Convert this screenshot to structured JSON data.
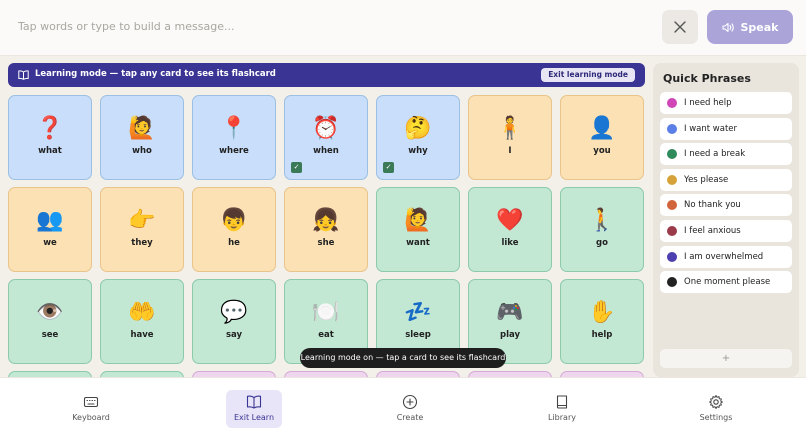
{
  "message_bar": {
    "placeholder": "Tap words or type to build a message...",
    "speak_label": "Speak"
  },
  "banner": {
    "text": "Learning mode — tap any card to see its flashcard",
    "exit_label": "Exit learning mode"
  },
  "cards": [
    {
      "label": "what",
      "emoji": "❓",
      "color": "blue",
      "badge": false
    },
    {
      "label": "who",
      "emoji": "🙋",
      "color": "blue",
      "badge": false
    },
    {
      "label": "where",
      "emoji": "📍",
      "color": "blue",
      "badge": false
    },
    {
      "label": "when",
      "emoji": "⏰",
      "color": "blue",
      "badge": true
    },
    {
      "label": "why",
      "emoji": "🤔",
      "color": "blue",
      "badge": true
    },
    {
      "label": "I",
      "emoji": "🧍",
      "color": "yellow",
      "badge": false
    },
    {
      "label": "you",
      "emoji": "👤",
      "color": "yellow",
      "badge": false
    },
    {
      "label": "we",
      "emoji": "👥",
      "color": "yellow",
      "badge": false
    },
    {
      "label": "they",
      "emoji": "👉",
      "color": "yellow",
      "badge": false
    },
    {
      "label": "he",
      "emoji": "👦",
      "color": "yellow",
      "badge": false
    },
    {
      "label": "she",
      "emoji": "👧",
      "color": "yellow",
      "badge": false
    },
    {
      "label": "want",
      "emoji": "🙋",
      "color": "green",
      "badge": false
    },
    {
      "label": "like",
      "emoji": "❤️",
      "color": "green",
      "badge": false
    },
    {
      "label": "go",
      "emoji": "🚶",
      "color": "green",
      "badge": false
    },
    {
      "label": "see",
      "emoji": "👁️",
      "color": "green",
      "badge": false
    },
    {
      "label": "have",
      "emoji": "🤲",
      "color": "green",
      "badge": false
    },
    {
      "label": "say",
      "emoji": "💬",
      "color": "green",
      "badge": false
    },
    {
      "label": "eat",
      "emoji": "🍽️",
      "color": "green",
      "badge": false
    },
    {
      "label": "sleep",
      "emoji": "💤",
      "color": "green",
      "badge": false
    },
    {
      "label": "play",
      "emoji": "🎮",
      "color": "green",
      "badge": false
    },
    {
      "label": "help",
      "emoji": "✋",
      "color": "green",
      "badge": false
    },
    {
      "label": "",
      "emoji": "",
      "color": "green",
      "badge": false
    },
    {
      "label": "",
      "emoji": "",
      "color": "green",
      "badge": false
    },
    {
      "label": "",
      "emoji": "",
      "color": "pink",
      "badge": false
    },
    {
      "label": "",
      "emoji": "",
      "color": "pink",
      "badge": false
    },
    {
      "label": "",
      "emoji": "",
      "color": "pink",
      "badge": false
    },
    {
      "label": "",
      "emoji": "",
      "color": "pink",
      "badge": false
    },
    {
      "label": "",
      "emoji": "",
      "color": "pink",
      "badge": false
    }
  ],
  "quick_phrases": {
    "title": "Quick Phrases",
    "add_label": "+",
    "items": [
      {
        "label": "I need help",
        "color": "#d046b7"
      },
      {
        "label": "I want water",
        "color": "#5b7fe6"
      },
      {
        "label": "I need a break",
        "color": "#2f8a5c"
      },
      {
        "label": "Yes please",
        "color": "#d6a23a"
      },
      {
        "label": "No thank you",
        "color": "#d2643c"
      },
      {
        "label": "I feel anxious",
        "color": "#9b3a4a"
      },
      {
        "label": "I am overwhelmed",
        "color": "#4e3fb0"
      },
      {
        "label": "One moment please",
        "color": "#222222"
      }
    ]
  },
  "toast": "Learning mode on — tap a card to see its flashcard",
  "nav": [
    {
      "label": "Keyboard",
      "icon": "keyboard-icon",
      "active": false
    },
    {
      "label": "Exit Learn",
      "icon": "book-open-icon",
      "active": true
    },
    {
      "label": "Create",
      "icon": "plus-circle-icon",
      "active": false
    },
    {
      "label": "Library",
      "icon": "book-icon",
      "active": false
    },
    {
      "label": "Settings",
      "icon": "gear-icon",
      "active": false
    }
  ],
  "colors": {
    "accent": "#3a3494",
    "speak_button": "#aaa4d9",
    "card_blue": "#c8defa",
    "card_yellow": "#fbe1b4",
    "card_green": "#c2e8d4",
    "card_pink": "#efd6ef"
  }
}
